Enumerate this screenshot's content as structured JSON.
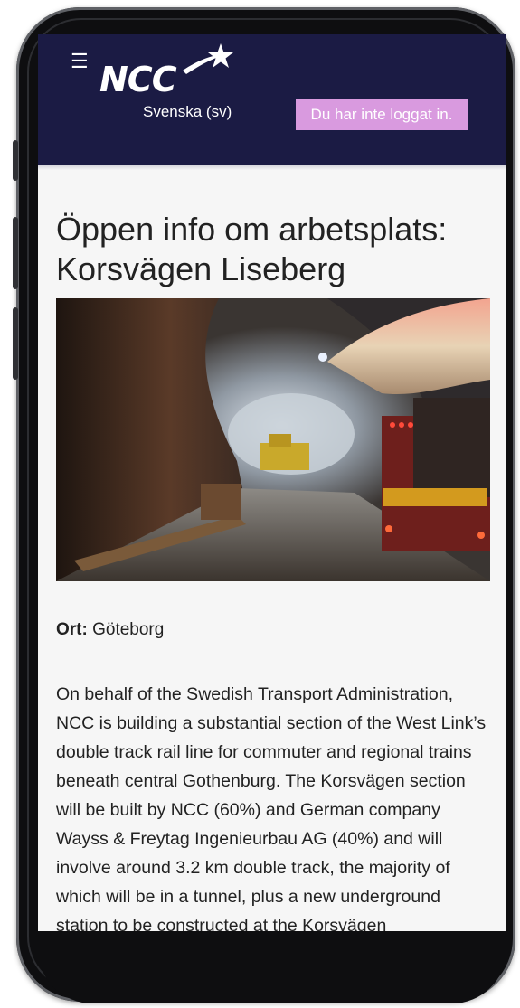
{
  "header": {
    "menu_icon": "☰",
    "logo_text": "NCC",
    "language": "Svenska (sv)",
    "login_status": "Du har inte loggat in."
  },
  "page": {
    "title": "Öppen info om arbetsplats: Korsvägen Liseberg",
    "photo_icon": "tunnel-photo",
    "location_label": "Ort:",
    "location_value": " Göteborg",
    "description": "On behalf of the Swedish Transport Administration, NCC is building a substantial section of the West Link’s double track rail line for commuter and regional trains beneath central Gothenburg. The Korsvägen section will be built by NCC (60%) and German company Wayss & Freytag Ingenieurbau AG (40%) and will involve around 3.2 km double track, the majority of which will be in a tunnel, plus a new underground station to be constructed at the Korsvägen"
  },
  "colors": {
    "header_bg": "#1b1b44",
    "login_badge": "#d99adf",
    "page_bg": "#f6f6f6"
  }
}
